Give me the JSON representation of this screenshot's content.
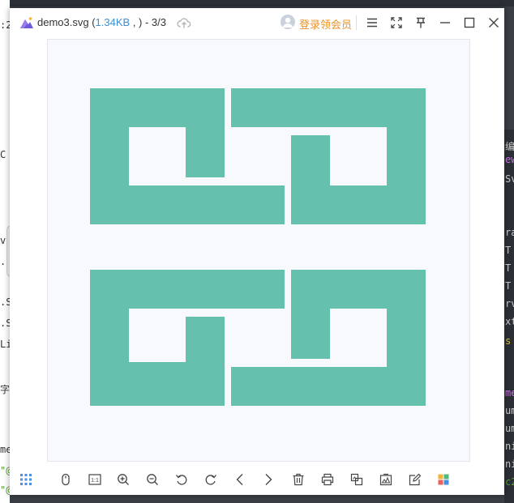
{
  "window": {
    "title_filename": "demo3.svg",
    "title_open_paren": " (",
    "title_size": "1.34KB",
    "title_rest": " , ) - 3/3",
    "vip_label": "登录领会员"
  },
  "colors": {
    "shape_fill": "#66c0ae",
    "canvas_bg": "#f8f9fd",
    "accent_blue": "#3b8fd6",
    "vip_orange": "#e8922c"
  },
  "titlebar_buttons": [
    {
      "name": "menu-icon"
    },
    {
      "name": "fullscreen-icon"
    },
    {
      "name": "pin-icon"
    },
    {
      "name": "minimize-icon"
    },
    {
      "name": "maximize-icon"
    },
    {
      "name": "close-icon"
    }
  ],
  "bottom_toolbar": [
    {
      "name": "grid-view-icon"
    },
    {
      "name": "mouse-icon"
    },
    {
      "name": "actual-size-icon",
      "label": "1:1"
    },
    {
      "name": "zoom-in-icon"
    },
    {
      "name": "zoom-out-icon"
    },
    {
      "name": "rotate-left-icon"
    },
    {
      "name": "rotate-right-icon"
    },
    {
      "name": "previous-icon"
    },
    {
      "name": "next-icon"
    },
    {
      "name": "delete-icon"
    },
    {
      "name": "print-icon"
    },
    {
      "name": "convert-icon"
    },
    {
      "name": "image-edit-icon"
    },
    {
      "name": "edit-icon"
    },
    {
      "name": "apps-icon"
    }
  ],
  "background_fragments": {
    "left": [
      ":2",
      "C",
      "vg",
      ".S",
      ".S",
      ".S",
      "Li",
      "字",
      "me",
      "\"@",
      "\"@"
    ],
    "right": [
      "编",
      "ew",
      "Sv",
      "ra",
      "T",
      "T",
      "T",
      "rv",
      "xt",
      "s",
      "me",
      "um",
      "um",
      "ni",
      "ni",
      "c2"
    ]
  }
}
